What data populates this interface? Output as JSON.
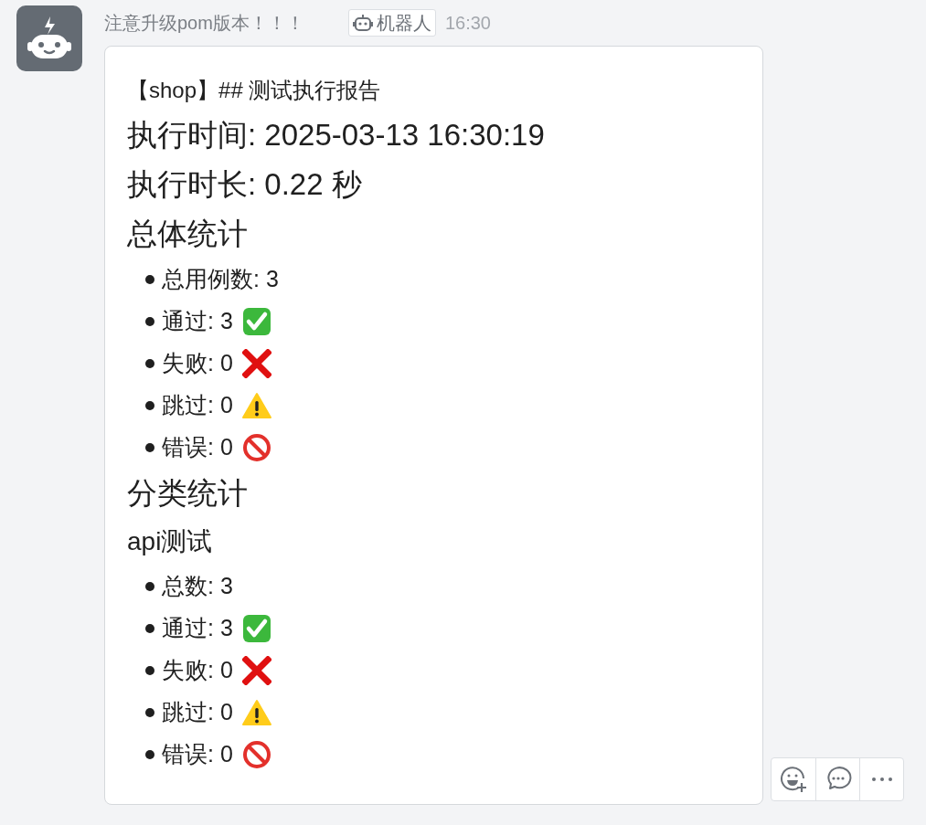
{
  "message": {
    "sender": "注意升级pom版本！！！",
    "badge": "机器人",
    "time": "16:30",
    "blocks": [
      {
        "kind": "title",
        "text": "【shop】## 测试执行报告"
      },
      {
        "kind": "heading",
        "text": "执行时间: 2025-03-13 16:30:19"
      },
      {
        "kind": "heading",
        "text": "执行时长: 0.22 秒"
      },
      {
        "kind": "heading",
        "text": "总体统计"
      },
      {
        "kind": "list",
        "items": [
          {
            "text": "总用例数: 3",
            "kind": "plain"
          },
          {
            "text": "通过: 3",
            "kind": "check"
          },
          {
            "text": "失败: 0",
            "kind": "cross"
          },
          {
            "text": "跳过: 0",
            "kind": "warning"
          },
          {
            "text": "错误: 0",
            "kind": "prohibited"
          }
        ]
      },
      {
        "kind": "heading",
        "text": "分类统计"
      },
      {
        "kind": "subheading",
        "text": "api测试"
      },
      {
        "kind": "list",
        "items": [
          {
            "text": "总数: 3",
            "kind": "plain"
          },
          {
            "text": "通过: 3",
            "kind": "check"
          },
          {
            "text": "失败: 0",
            "kind": "cross"
          },
          {
            "text": "跳过: 0",
            "kind": "warning"
          },
          {
            "text": "错误: 0",
            "kind": "prohibited"
          }
        ]
      }
    ]
  }
}
